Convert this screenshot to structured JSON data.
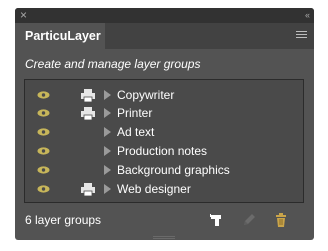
{
  "panel": {
    "close_glyph": "×",
    "collapse_glyph": "‹‹",
    "tab_label": "ParticuLayer",
    "subtitle": "Create and manage layer groups",
    "rows": [
      {
        "label": "Copywriter",
        "printable": true,
        "visible": true
      },
      {
        "label": "Printer",
        "printable": true,
        "visible": true
      },
      {
        "label": "Ad text",
        "printable": false,
        "visible": true
      },
      {
        "label": "Production notes",
        "printable": false,
        "visible": true
      },
      {
        "label": "Background graphics",
        "printable": false,
        "visible": true
      },
      {
        "label": "Web designer",
        "printable": true,
        "visible": true
      }
    ],
    "footer_count": "6 layer groups"
  },
  "colors": {
    "panel_bg": "#535353",
    "eye_icon": "#c7b65a",
    "printer_icon": "#e6e6e6",
    "trash_icon": "#c9a44a",
    "pencil_icon": "#6b6b6b"
  }
}
